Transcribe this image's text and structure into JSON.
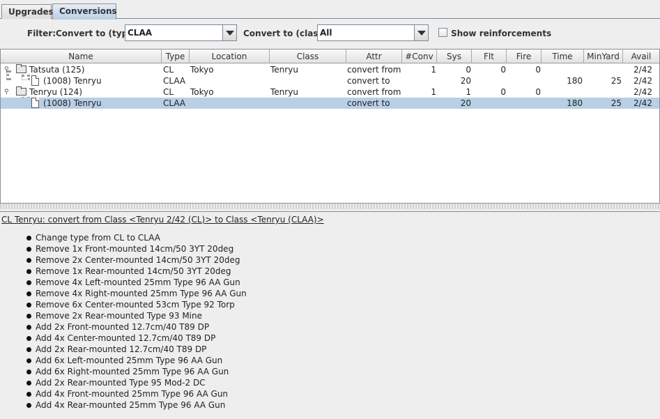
{
  "tabs": [
    {
      "label": "Upgrades",
      "active": false
    },
    {
      "label": "Conversions",
      "active": true
    }
  ],
  "filter": {
    "label": "Filter:",
    "type_label": "Convert to (type):",
    "type_value": "CLAA",
    "class_label": "Convert to (class):",
    "class_value": "All",
    "reinforcements_label": "Show reinforcements",
    "reinforcements_checked": false
  },
  "table": {
    "columns": [
      "Name",
      "Type",
      "Location",
      "Class",
      "Attr",
      "#Conv",
      "Sys",
      "Flt",
      "Fire",
      "Time",
      "MinYard",
      "Avail"
    ],
    "rows": [
      {
        "name": "Tatsuta (125)",
        "type": "CL",
        "location": "Tokyo",
        "class": "Tenryu",
        "attr": "convert from",
        "conv": "1",
        "sys": "0",
        "flt": "0",
        "fire": "0",
        "time": "",
        "minyard": "",
        "avail": "2/42"
      },
      {
        "name": "(1008) Tenryu",
        "type": "CLAA",
        "location": "",
        "class": "",
        "attr": "convert to",
        "conv": "",
        "sys": "20",
        "flt": "",
        "fire": "",
        "time": "180",
        "minyard": "25",
        "avail": "2/42"
      },
      {
        "name": "Tenryu (124)",
        "type": "CL",
        "location": "Tokyo",
        "class": "Tenryu",
        "attr": "convert from",
        "conv": "1",
        "sys": "1",
        "flt": "0",
        "fire": "0",
        "time": "",
        "minyard": "",
        "avail": "2/42"
      },
      {
        "name": "(1008) Tenryu",
        "type": "CLAA",
        "location": "",
        "class": "",
        "attr": "convert to",
        "conv": "",
        "sys": "20",
        "flt": "",
        "fire": "",
        "time": "180",
        "minyard": "25",
        "avail": "2/42"
      }
    ]
  },
  "detail": {
    "title": "CL Tenryu: convert from Class <Tenryu 2/42 (CL)> to Class <Tenryu (CLAA)>",
    "items": [
      "Change type from CL to CLAA",
      "Remove 1x Front-mounted 14cm/50 3YT 20deg",
      "Remove 2x Center-mounted 14cm/50 3YT 20deg",
      "Remove 1x Rear-mounted 14cm/50 3YT 20deg",
      "Remove 4x Left-mounted 25mm Type 96 AA Gun",
      "Remove 4x Right-mounted 25mm Type 96 AA Gun",
      "Remove 6x Center-mounted 53cm Type 92 Torp",
      "Remove 2x Rear-mounted Type 93 Mine",
      "Add 2x Front-mounted 12.7cm/40 T89 DP",
      "Add 4x Center-mounted 12.7cm/40 T89 DP",
      "Add 2x Rear-mounted 12.7cm/40 T89 DP",
      "Add 6x Left-mounted 25mm Type 96 AA Gun",
      "Add 6x Right-mounted 25mm Type 96 AA Gun",
      "Add 2x Rear-mounted Type 95 Mod-2 DC",
      "Add 4x Front-mounted 25mm Type 96 AA Gun",
      "Add 4x Rear-mounted 25mm Type 96 AA Gun"
    ]
  },
  "colors": {
    "selected_row": "#b8cfe5",
    "active_tab": "#b8cfe5"
  },
  "icons": {
    "group": "folder-icon",
    "leaf": "document-icon",
    "chevron": "chevron-down-icon"
  }
}
